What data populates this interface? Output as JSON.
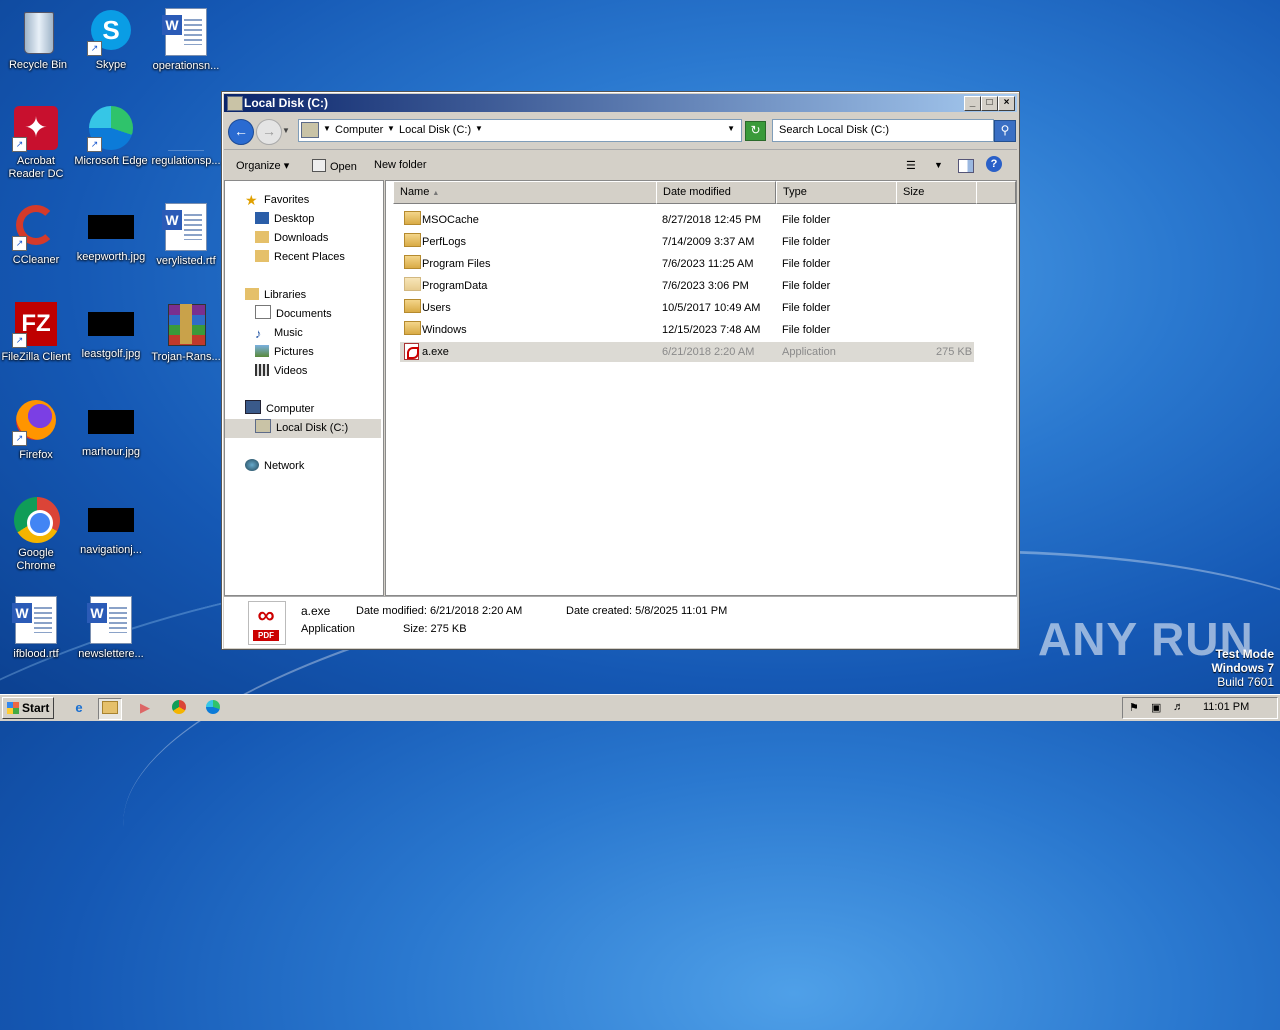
{
  "desktop": {
    "icons": [
      {
        "label": "Recycle Bin"
      },
      {
        "label": "Skype"
      },
      {
        "label": "operationsn..."
      },
      {
        "label": "Acrobat Reader DC"
      },
      {
        "label": "Microsoft Edge"
      },
      {
        "label": "regulationsp..."
      },
      {
        "label": "CCleaner"
      },
      {
        "label": "keepworth.jpg"
      },
      {
        "label": "verylisted.rtf"
      },
      {
        "label": "FileZilla Client"
      },
      {
        "label": "leastgolf.jpg"
      },
      {
        "label": "Trojan-Rans..."
      },
      {
        "label": "Firefox"
      },
      {
        "label": "marhour.jpg"
      },
      {
        "label": "Google Chrome"
      },
      {
        "label": "navigationj..."
      },
      {
        "label": "ifblood.rtf"
      },
      {
        "label": "newslettere..."
      }
    ]
  },
  "window": {
    "title": "Local Disk (C:)",
    "address": {
      "crumbs": [
        "Computer",
        "Local Disk (C:)"
      ]
    },
    "search_placeholder": "Search Local Disk (C:)",
    "commands": {
      "organize": "Organize",
      "open": "Open",
      "new_folder": "New folder"
    },
    "nav": {
      "favorites": "Favorites",
      "desktop": "Desktop",
      "downloads": "Downloads",
      "recent": "Recent Places",
      "libraries": "Libraries",
      "documents": "Documents",
      "music": "Music",
      "pictures": "Pictures",
      "videos": "Videos",
      "computer": "Computer",
      "localdisk": "Local Disk (C:)",
      "network": "Network"
    },
    "columns": {
      "name": "Name",
      "date": "Date modified",
      "type": "Type",
      "size": "Size"
    },
    "files": [
      {
        "name": "MSOCache",
        "date": "8/27/2018 12:45 PM",
        "type": "File folder",
        "size": ""
      },
      {
        "name": "PerfLogs",
        "date": "7/14/2009 3:37 AM",
        "type": "File folder",
        "size": ""
      },
      {
        "name": "Program Files",
        "date": "7/6/2023 11:25 AM",
        "type": "File folder",
        "size": ""
      },
      {
        "name": "ProgramData",
        "date": "7/6/2023 3:06 PM",
        "type": "File folder",
        "size": ""
      },
      {
        "name": "Users",
        "date": "10/5/2017 10:49 AM",
        "type": "File folder",
        "size": ""
      },
      {
        "name": "Windows",
        "date": "12/15/2023 7:48 AM",
        "type": "File folder",
        "size": ""
      },
      {
        "name": "a.exe",
        "date": "6/21/2018 2:20 AM",
        "type": "Application",
        "size": "275 KB"
      }
    ],
    "details": {
      "name": "a.exe",
      "type": "Application",
      "modified": "Date modified: 6/21/2018 2:20 AM",
      "size": "Size: 275 KB",
      "created": "Date created: 5/8/2025 11:01 PM",
      "icon_tag": "PDF"
    }
  },
  "watermark": {
    "brand": "ANY RUN",
    "line1": "Test Mode",
    "line2": "Windows 7",
    "line3": "Build 7601"
  },
  "taskbar": {
    "start": "Start",
    "clock": "11:01 PM"
  }
}
